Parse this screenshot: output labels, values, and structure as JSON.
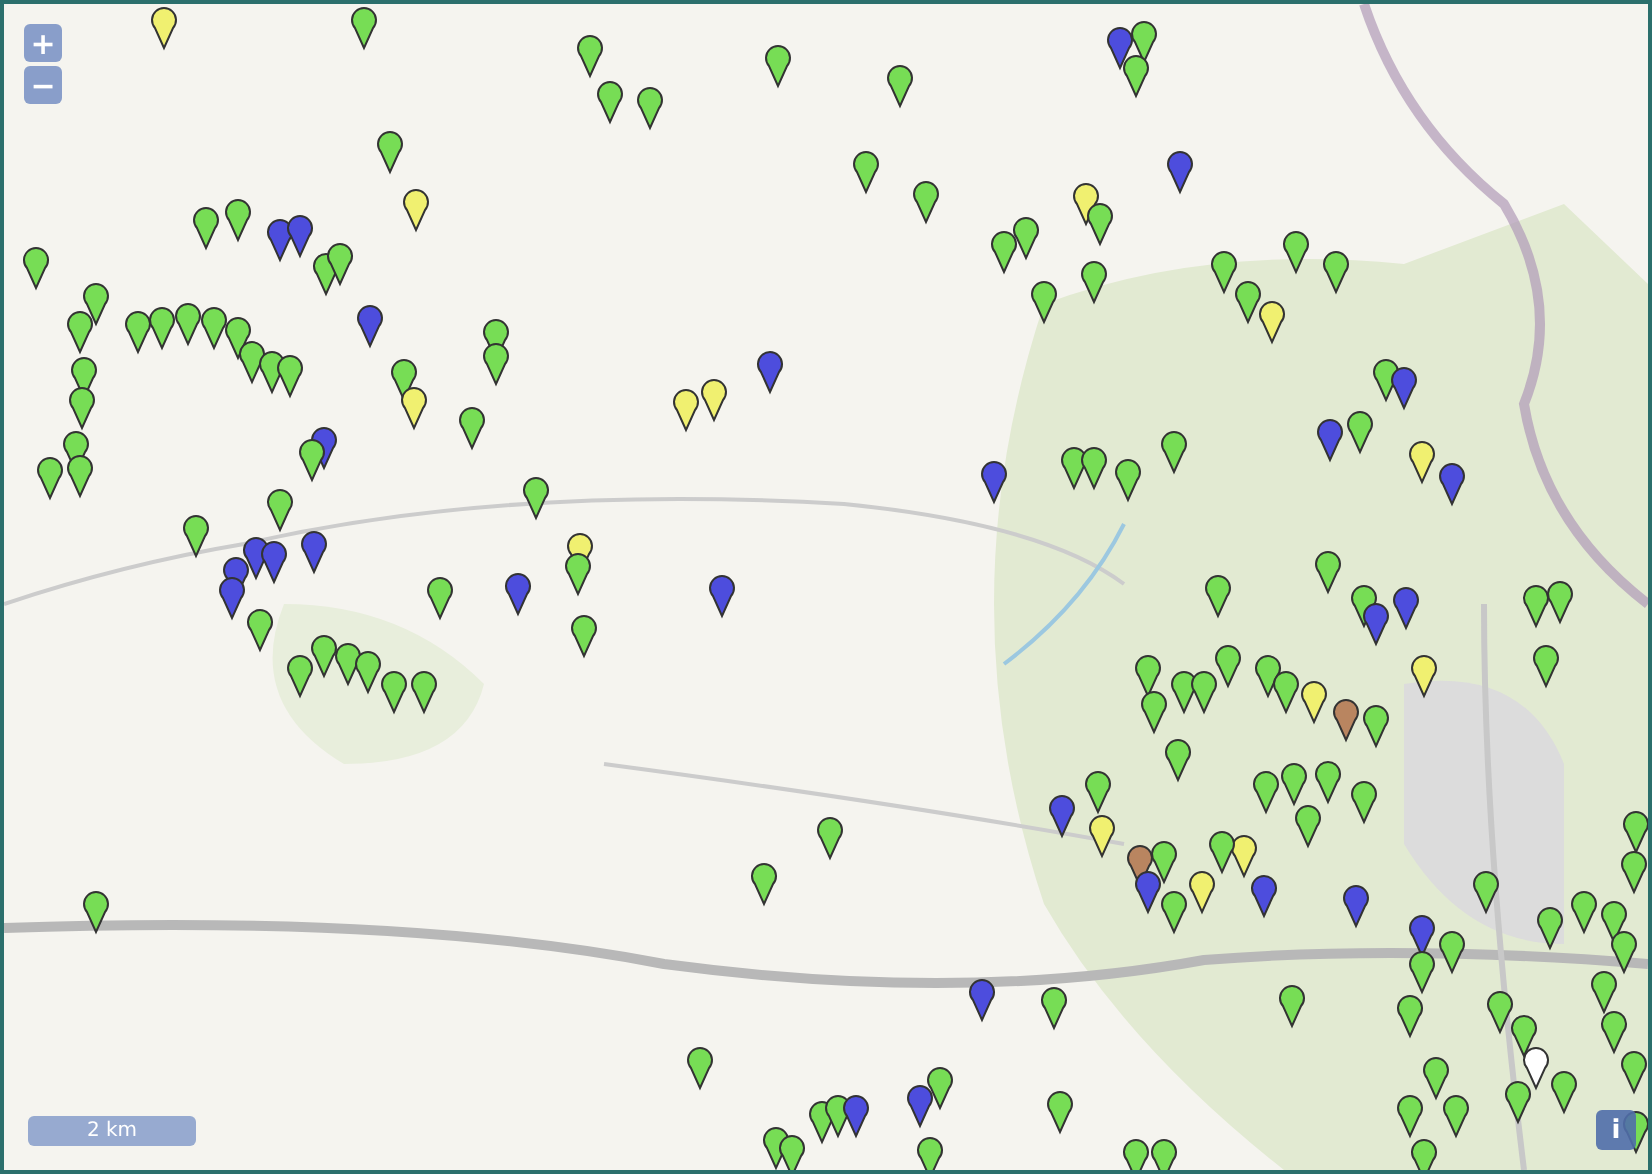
{
  "controls": {
    "zoom_in": "+",
    "zoom_out": "−",
    "scale": "2 km",
    "info": "i"
  },
  "markers": [
    {
      "color": "#f0f070"
    },
    {
      "color": "#77dd55"
    },
    {
      "color": "#77dd55"
    },
    {
      "color": "#77dd55"
    },
    {
      "color": "#77dd55"
    },
    {
      "color": "#77dd55"
    },
    {
      "color": "#77dd55"
    },
    {
      "color": "#4d4ddd"
    },
    {
      "color": "#77dd55"
    },
    {
      "color": "#77dd55"
    },
    {
      "color": "#77dd55"
    },
    {
      "color": "#f0f070"
    },
    {
      "color": "#77dd55"
    },
    {
      "color": "#77dd55"
    },
    {
      "color": "#4d4ddd"
    },
    {
      "color": "#4d4ddd"
    },
    {
      "color": "#77dd55"
    },
    {
      "color": "#77dd55"
    },
    {
      "color": "#77dd55"
    },
    {
      "color": "#77dd55"
    },
    {
      "color": "#77dd55"
    },
    {
      "color": "#77dd55"
    },
    {
      "color": "#77dd55"
    },
    {
      "color": "#77dd55"
    },
    {
      "color": "#77dd55"
    },
    {
      "color": "#77dd55"
    },
    {
      "color": "#77dd55"
    },
    {
      "color": "#77dd55"
    },
    {
      "color": "#77dd55"
    },
    {
      "color": "#4d4ddd"
    },
    {
      "color": "#77dd55"
    },
    {
      "color": "#77dd55"
    },
    {
      "color": "#77dd55"
    },
    {
      "color": "#f0f070"
    },
    {
      "color": "#77dd55"
    },
    {
      "color": "#77dd55"
    },
    {
      "color": "#77dd55"
    },
    {
      "color": "#77dd55"
    },
    {
      "color": "#77dd55"
    },
    {
      "color": "#77dd55"
    },
    {
      "color": "#4d4ddd"
    },
    {
      "color": "#77dd55"
    },
    {
      "color": "#77dd55"
    },
    {
      "color": "#77dd55"
    },
    {
      "color": "#4d4ddd"
    },
    {
      "color": "#4d4ddd"
    },
    {
      "color": "#4d4ddd"
    },
    {
      "color": "#4d4ddd"
    },
    {
      "color": "#4d4ddd"
    },
    {
      "color": "#77dd55"
    },
    {
      "color": "#f0f070"
    },
    {
      "color": "#77dd55"
    },
    {
      "color": "#77dd55"
    },
    {
      "color": "#4d4ddd"
    },
    {
      "color": "#77dd55"
    },
    {
      "color": "#4d4ddd"
    },
    {
      "color": "#77dd55"
    },
    {
      "color": "#77dd55"
    },
    {
      "color": "#77dd55"
    },
    {
      "color": "#77dd55"
    },
    {
      "color": "#77dd55"
    },
    {
      "color": "#77dd55"
    },
    {
      "color": "#77dd55"
    },
    {
      "color": "#f0f070"
    },
    {
      "color": "#f0f070"
    },
    {
      "color": "#4d4ddd"
    },
    {
      "color": "#77dd55"
    },
    {
      "color": "#77dd55"
    },
    {
      "color": "#4d4ddd"
    },
    {
      "color": "#f0f070"
    },
    {
      "color": "#77dd55"
    },
    {
      "color": "#77dd55"
    },
    {
      "color": "#77dd55"
    },
    {
      "color": "#77dd55"
    },
    {
      "color": "#77dd55"
    },
    {
      "color": "#77dd55"
    },
    {
      "color": "#77dd55"
    },
    {
      "color": "#f0f070"
    },
    {
      "color": "#77dd55"
    },
    {
      "color": "#77dd55"
    },
    {
      "color": "#77dd55"
    },
    {
      "color": "#4d4ddd"
    },
    {
      "color": "#4d4ddd"
    },
    {
      "color": "#77dd55"
    },
    {
      "color": "#f0f070"
    },
    {
      "color": "#4d4ddd"
    },
    {
      "color": "#4d4ddd"
    },
    {
      "color": "#77dd55"
    },
    {
      "color": "#77dd55"
    },
    {
      "color": "#77dd55"
    },
    {
      "color": "#77dd55"
    },
    {
      "color": "#77dd55"
    },
    {
      "color": "#77dd55"
    },
    {
      "color": "#77dd55"
    },
    {
      "color": "#4d4ddd"
    },
    {
      "color": "#4d4ddd"
    },
    {
      "color": "#f0f070"
    },
    {
      "color": "#77dd55"
    },
    {
      "color": "#77dd55"
    },
    {
      "color": "#77dd55"
    },
    {
      "color": "#77dd55"
    },
    {
      "color": "#77dd55"
    },
    {
      "color": "#77dd55"
    },
    {
      "color": "#77dd55"
    },
    {
      "color": "#77dd55"
    },
    {
      "color": "#77dd55"
    },
    {
      "color": "#77dd55"
    },
    {
      "color": "#f0f070"
    },
    {
      "color": "#b98560"
    },
    {
      "color": "#77dd55"
    },
    {
      "color": "#77dd55"
    },
    {
      "color": "#77dd55"
    },
    {
      "color": "#77dd55"
    },
    {
      "color": "#4d4ddd"
    },
    {
      "color": "#f0f070"
    },
    {
      "color": "#b98560"
    },
    {
      "color": "#77dd55"
    },
    {
      "color": "#f0f070"
    },
    {
      "color": "#4d4ddd"
    },
    {
      "color": "#77dd55"
    },
    {
      "color": "#77dd55"
    },
    {
      "color": "#77dd55"
    },
    {
      "color": "#77dd55"
    },
    {
      "color": "#77dd55"
    },
    {
      "color": "#f0f070"
    },
    {
      "color": "#4d4ddd"
    },
    {
      "color": "#77dd55"
    },
    {
      "color": "#4d4ddd"
    },
    {
      "color": "#4d4ddd"
    },
    {
      "color": "#77dd55"
    },
    {
      "color": "#77dd55"
    },
    {
      "color": "#77dd55"
    },
    {
      "color": "#77dd55"
    },
    {
      "color": "#77dd55"
    },
    {
      "color": "#77dd55"
    },
    {
      "color": "#77dd55"
    },
    {
      "color": "#77dd55"
    },
    {
      "color": "#77dd55"
    },
    {
      "color": "#77dd55"
    },
    {
      "color": "#77dd55"
    },
    {
      "color": "#77dd55"
    },
    {
      "color": "#ffffff"
    },
    {
      "color": "#77dd55"
    },
    {
      "color": "#77dd55"
    },
    {
      "color": "#77dd55"
    },
    {
      "color": "#77dd55"
    },
    {
      "color": "#77dd55"
    },
    {
      "color": "#77dd55"
    },
    {
      "color": "#77dd55"
    },
    {
      "color": "#77dd55"
    },
    {
      "color": "#4d4ddd"
    },
    {
      "color": "#77dd55"
    },
    {
      "color": "#77dd55"
    },
    {
      "color": "#77dd55"
    },
    {
      "color": "#77dd55"
    },
    {
      "color": "#77dd55"
    },
    {
      "color": "#77dd55"
    },
    {
      "color": "#4d4ddd"
    },
    {
      "color": "#4d4ddd"
    },
    {
      "color": "#77dd55"
    },
    {
      "color": "#77dd55"
    },
    {
      "color": "#77dd55"
    },
    {
      "color": "#77dd55"
    },
    {
      "color": "#77dd55"
    },
    {
      "color": "#77dd55"
    },
    {
      "color": "#77dd55"
    },
    {
      "color": "#77dd55"
    },
    {
      "color": "#77dd55"
    },
    {
      "color": "#77dd55"
    },
    {
      "color": "#77dd55"
    }
  ]
}
